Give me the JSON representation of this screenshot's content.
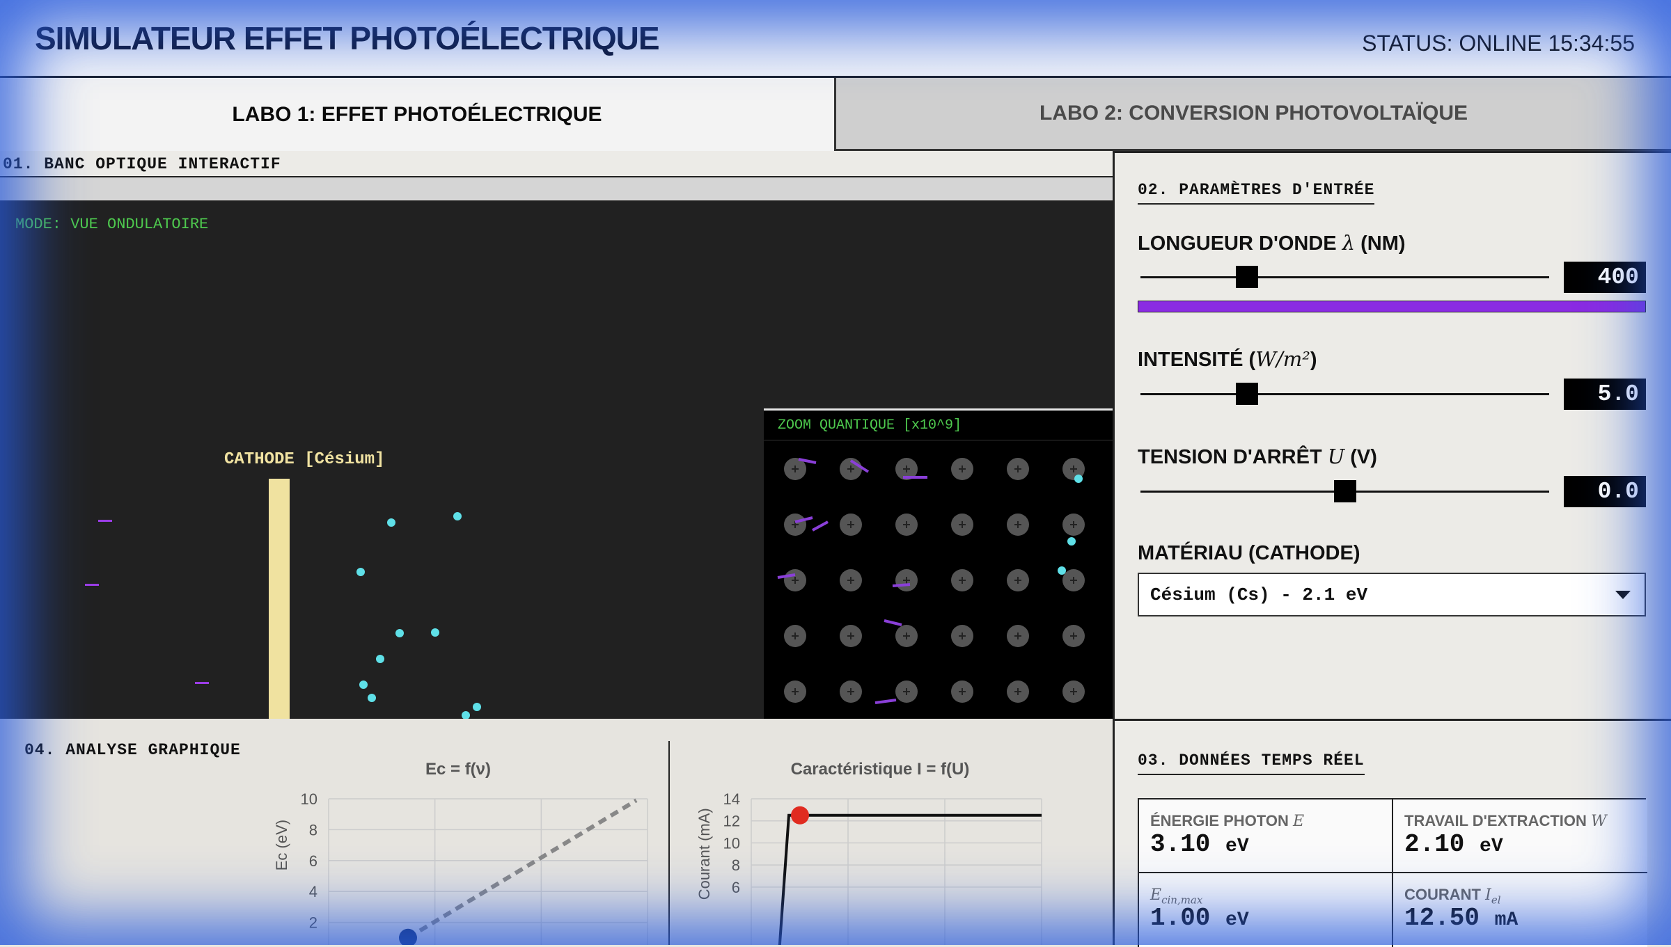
{
  "header": {
    "title": "SIMULATEUR EFFET PHOTOÉLECTRIQUE",
    "status": "STATUS: ONLINE 15:34:55"
  },
  "tabs": [
    {
      "label": "LABO 1: EFFET PHOTOÉLECTRIQUE",
      "active": true
    },
    {
      "label": "LABO 2: CONVERSION PHOTOVOLTAÏQUE",
      "active": false
    }
  ],
  "bench": {
    "section_title": "01. BANC OPTIQUE INTERACTIF",
    "mode": "MODE: VUE ONDULATOIRE",
    "cathode_label": "CATHODE [Césium]",
    "zoom_title": "ZOOM QUANTIQUE [x10^9]"
  },
  "params": {
    "section_title": "02. PARAMÈTRES D'ENTRÉE",
    "wavelength": {
      "label": "LONGUEUR D'ONDE",
      "symbol": "λ",
      "unit": "(NM)",
      "value": "400",
      "fraction": 0.26
    },
    "intensity": {
      "label": "INTENSITÉ",
      "unit_html": "W/m²",
      "value": "5.0",
      "fraction": 0.26
    },
    "stop_voltage": {
      "label": "TENSION D'ARRÊT",
      "symbol": "U",
      "unit": "(V)",
      "value": "0.0",
      "fraction": 0.5
    },
    "material": {
      "label": "MATÉRIAU (CATHODE)",
      "selected": "Césium (Cs) - 2.1 eV"
    },
    "spectrum_color": "#8a2be2"
  },
  "realtime": {
    "section_title": "03. DONNÉES TEMPS RÉEL",
    "cells": [
      {
        "label": "ÉNERGIE PHOTON",
        "symbol": "E",
        "value": "3.10",
        "unit": "eV"
      },
      {
        "label": "TRAVAIL D'EXTRACTION",
        "symbol": "W",
        "value": "2.10",
        "unit": "eV"
      },
      {
        "label": "",
        "symbol": "Ecin,max",
        "value": "1.00",
        "unit": "eV"
      },
      {
        "label": "COURANT",
        "symbol": "Iel",
        "value": "12.50",
        "unit": "mA"
      }
    ]
  },
  "graphs": {
    "section_title": "04. ANALYSE GRAPHIQUE"
  },
  "chart_data": [
    {
      "type": "line",
      "title": "Ec = f(ν)",
      "ylabel": "Ec (eV)",
      "xlabel": "",
      "yticks": [
        2,
        4,
        6,
        8,
        10
      ],
      "ylim": [
        0,
        10
      ],
      "series": [
        {
          "style": "dashed",
          "x": [
            0,
            1
          ],
          "y": [
            1.0,
            9.9
          ]
        }
      ],
      "point": {
        "x": 0,
        "y": 1.0
      },
      "grid": true
    },
    {
      "type": "line",
      "title": "Caractéristique I = f(U)",
      "ylabel": "Courant (mA)",
      "xlabel": "",
      "yticks": [
        6,
        8,
        10,
        12,
        14
      ],
      "ylim": [
        0,
        14
      ],
      "series": [
        {
          "style": "solid",
          "x": [
            0,
            0.12,
            1
          ],
          "y": [
            0,
            12.5,
            12.5
          ]
        }
      ],
      "point": {
        "x": 0.17,
        "y": 12.5
      },
      "grid": true
    }
  ]
}
